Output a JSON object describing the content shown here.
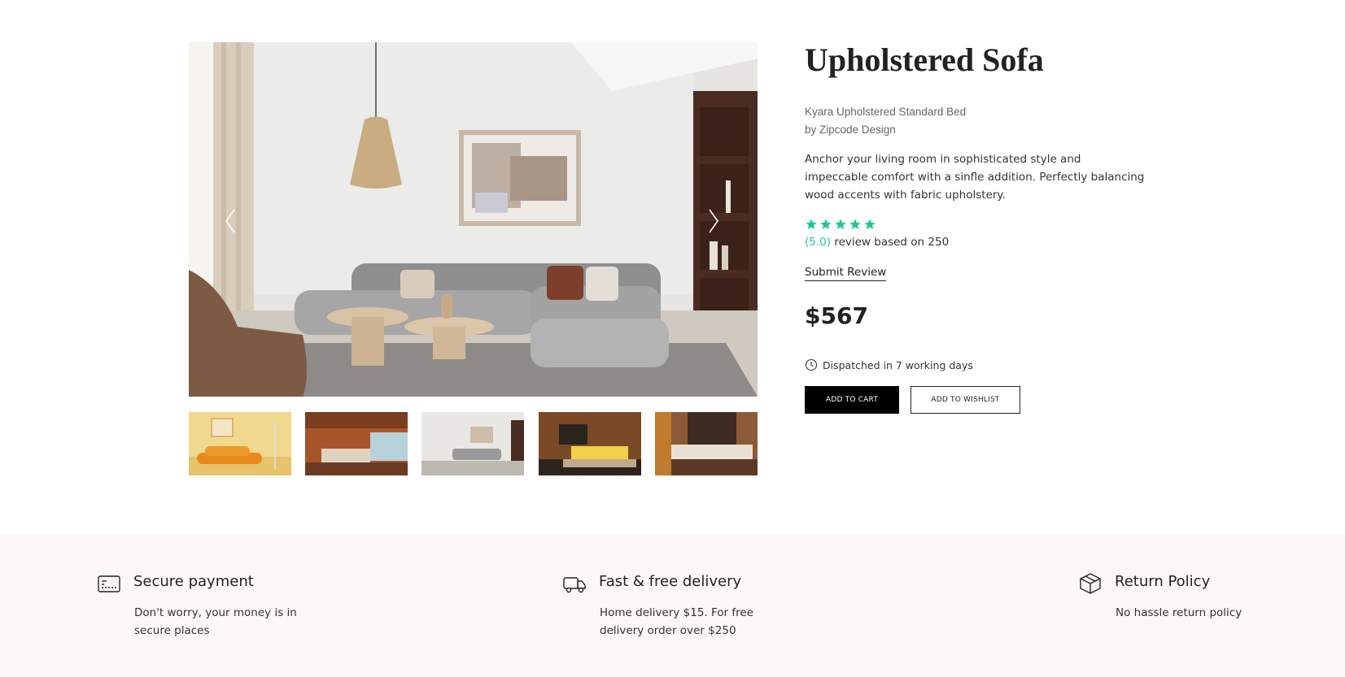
{
  "product": {
    "title": "Upholstered Sofa",
    "subtitle_line1": "Kyara Upholstered Standard Bed",
    "subtitle_line2": "by Zipcode Design",
    "description": "Anchor your living room in sophisticated style and impeccable comfort with a sinfle addition. Perfectly balancing wood accents with fabric upholstery.",
    "rating_value": 5,
    "rating_max": 5,
    "rating_score": "(5.0)",
    "rating_text": "review based on 250",
    "submit_review": "Submit Review",
    "price": "$567",
    "dispatch": "Dispatched in 7 working days",
    "add_to_cart": "ADD TO CART",
    "add_to_wishlist": "ADD TO WISHLIST",
    "star_color": "#21c39a"
  },
  "gallery": {
    "thumbnail_count": 5,
    "selected_thumbnail": 3
  },
  "features": [
    {
      "icon": "credit-card-icon",
      "title": "Secure payment",
      "text": "Don't worry, your money is in secure places"
    },
    {
      "icon": "truck-icon",
      "title": "Fast & free delivery",
      "text": "Home delivery $15. For free delivery order over $250"
    },
    {
      "icon": "box-icon",
      "title": "Return Policy",
      "text": "No hassle return policy"
    }
  ]
}
